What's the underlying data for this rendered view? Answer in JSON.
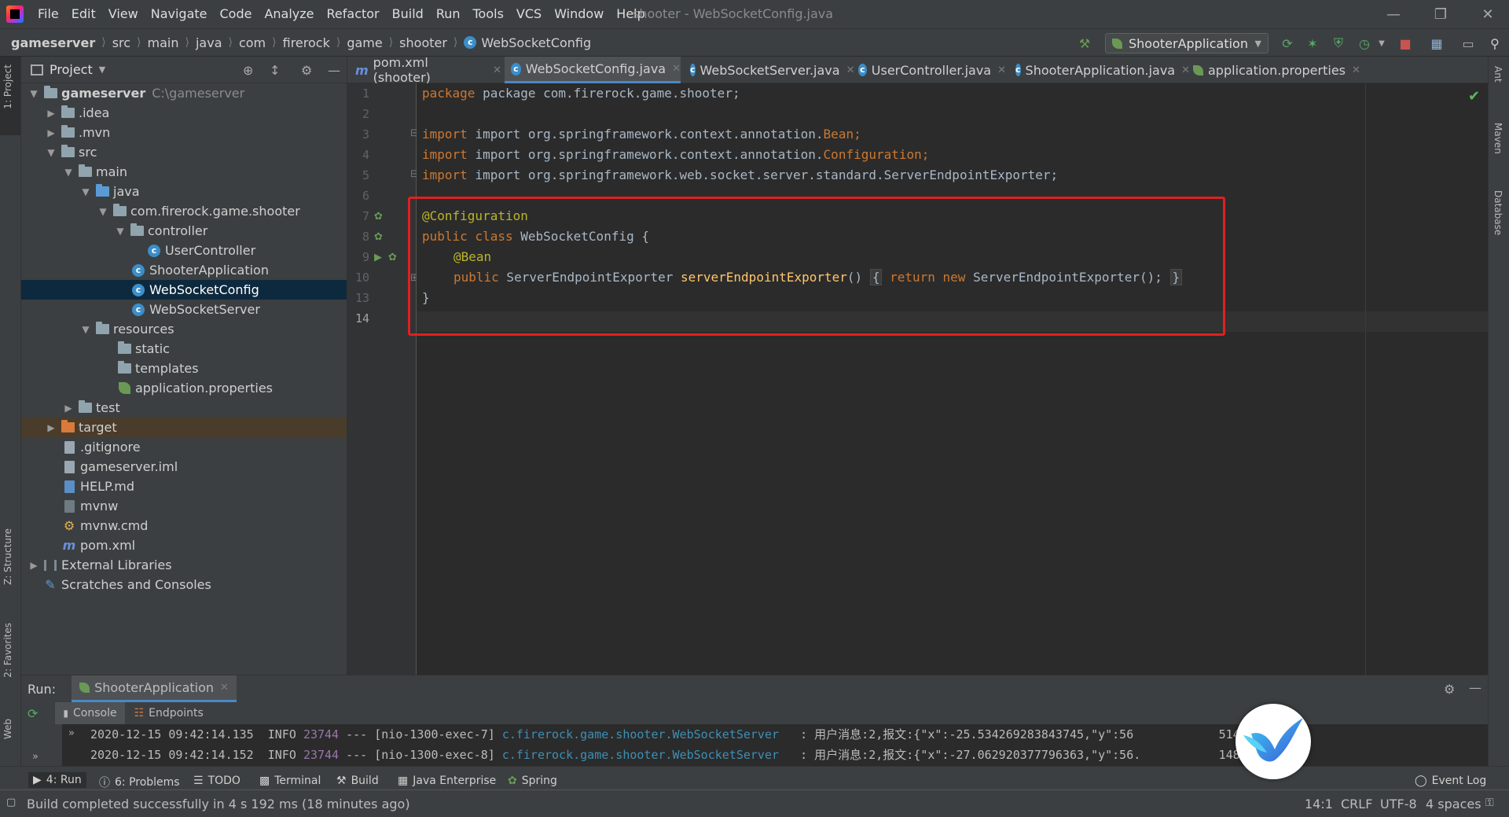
{
  "menu": [
    "File",
    "Edit",
    "View",
    "Navigate",
    "Code",
    "Analyze",
    "Refactor",
    "Build",
    "Run",
    "Tools",
    "VCS",
    "Window",
    "Help"
  ],
  "window_title": "shooter - WebSocketConfig.java",
  "breadcrumbs": [
    "gameserver",
    "src",
    "main",
    "java",
    "com",
    "firerock",
    "game",
    "shooter",
    "WebSocketConfig"
  ],
  "run_config": "ShooterApplication",
  "left_strip": {
    "project": "1: Project",
    "structure": "Z: Structure",
    "favorites": "2: Favorites",
    "web": "Web"
  },
  "right_strip": {
    "ant": "Ant",
    "maven": "Maven",
    "database": "Database"
  },
  "project_panel": {
    "title": "Project",
    "tree": [
      {
        "label": "gameserver",
        "sub": "C:\\gameserver"
      },
      {
        "label": ".idea"
      },
      {
        "label": ".mvn"
      },
      {
        "label": "src"
      },
      {
        "label": "main"
      },
      {
        "label": "java"
      },
      {
        "label": "com.firerock.game.shooter"
      },
      {
        "label": "controller"
      },
      {
        "label": "UserController"
      },
      {
        "label": "ShooterApplication"
      },
      {
        "label": "WebSocketConfig"
      },
      {
        "label": "WebSocketServer"
      },
      {
        "label": "resources"
      },
      {
        "label": "static"
      },
      {
        "label": "templates"
      },
      {
        "label": "application.properties"
      },
      {
        "label": "test"
      },
      {
        "label": "target"
      },
      {
        "label": ".gitignore"
      },
      {
        "label": "gameserver.iml"
      },
      {
        "label": "HELP.md"
      },
      {
        "label": "mvnw"
      },
      {
        "label": "mvnw.cmd"
      },
      {
        "label": "pom.xml"
      },
      {
        "label": "External Libraries"
      },
      {
        "label": "Scratches and Consoles"
      }
    ]
  },
  "editor_tabs": [
    "pom.xml (shooter)",
    "WebSocketConfig.java",
    "WebSocketServer.java",
    "UserController.java",
    "ShooterApplication.java",
    "application.properties"
  ],
  "line_numbers": [
    "1",
    "2",
    "3",
    "4",
    "5",
    "6",
    "7",
    "8",
    "9",
    "10",
    "13",
    "14"
  ],
  "code": {
    "l1": "package com.firerock.game.shooter;",
    "l3a": "import org.springframework.context.annotation.",
    "l3b": "Bean",
    "l4a": "import org.springframework.context.annotation.",
    "l4b": "Configuration",
    "l5": "import org.springframework.web.socket.server.standard.ServerEndpointExporter;",
    "l7": "@Configuration",
    "l8_kw": "public class",
    "l8_rest": " WebSocketConfig {",
    "l9": "@Bean",
    "l10_kw": "public",
    "l10_type": " ServerEndpointExporter ",
    "l10_fn": "serverEndpointExporter",
    "l10_paren": "()",
    "l10_open": "{",
    "l10_ret": "return",
    "l10_new": "new",
    "l10_rest": " ServerEndpointExporter();",
    "l10_close": "}",
    "l13": "}",
    "semi": ";"
  },
  "run_panel": {
    "label": "Run:",
    "config_tab": "ShooterApplication",
    "subtabs": [
      "Console",
      "Endpoints"
    ],
    "log": [
      {
        "ts": "2020-12-15 09:42:14.135",
        "level": "INFO",
        "pid": "23744",
        "sep": "---",
        "thread": "[nio-1300-exec-7]",
        "cls": "c.firerock.game.shooter.WebSocketServer",
        "msg": " : 用户消息:2,报文:{\"x\":-25.534269283843745,\"y\":56",
        "tail": "514631}"
      },
      {
        "ts": "2020-12-15 09:42:14.152",
        "level": "INFO",
        "pid": "23744",
        "sep": "---",
        "thread": "[nio-1300-exec-8]",
        "cls": "c.firerock.game.shooter.WebSocketServer",
        "msg": " : 用户消息:2,报文:{\"x\":-27.062920377796363,\"y\":56.",
        "tail": "148584}"
      }
    ]
  },
  "bottom_tools": [
    "4: Run",
    "6: Problems",
    "TODO",
    "Terminal",
    "Build",
    "Java Enterprise",
    "Spring"
  ],
  "event_log": "Event Log",
  "status": {
    "message": "Build completed successfully in 4 s 192 ms (18 minutes ago)",
    "position": "14:1",
    "line_sep": "CRLF",
    "encoding": "UTF-8",
    "indent": "4 spaces"
  },
  "colors": {
    "keyword": "#cc7832",
    "annotation": "#bbb529",
    "function": "#ffc66d",
    "highlight": "#e02020",
    "selection": "#0d293e"
  }
}
